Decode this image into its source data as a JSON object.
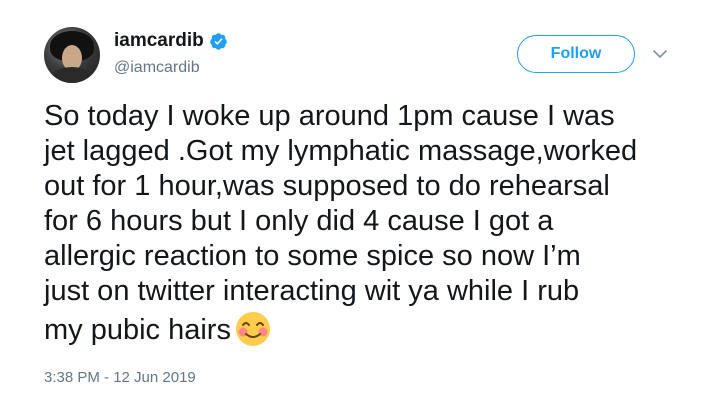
{
  "user": {
    "display_name": "iamcardib",
    "handle": "@iamcardib",
    "verified": true
  },
  "actions": {
    "follow_label": "Follow"
  },
  "tweet": {
    "lines": [
      "So today I woke up around 1pm cause I was",
      "jet lagged .Got my lymphatic massage,worked",
      "out for 1 hour,was supposed to do rehearsal",
      "for 6 hours but I only did 4 cause I got a",
      "allergic reaction to some spice so now I’m",
      "just on twitter interacting wit ya while I rub",
      "my pubic hairs"
    ],
    "emoji": "smiling-face-with-blushed-cheeks",
    "timestamp": "3:38 PM - 12 Jun 2019"
  },
  "colors": {
    "accent": "#1da1f2",
    "text": "#14171a",
    "muted": "#657786"
  },
  "icons": {
    "verified": "verified-badge-icon",
    "menu": "chevron-down-icon"
  }
}
